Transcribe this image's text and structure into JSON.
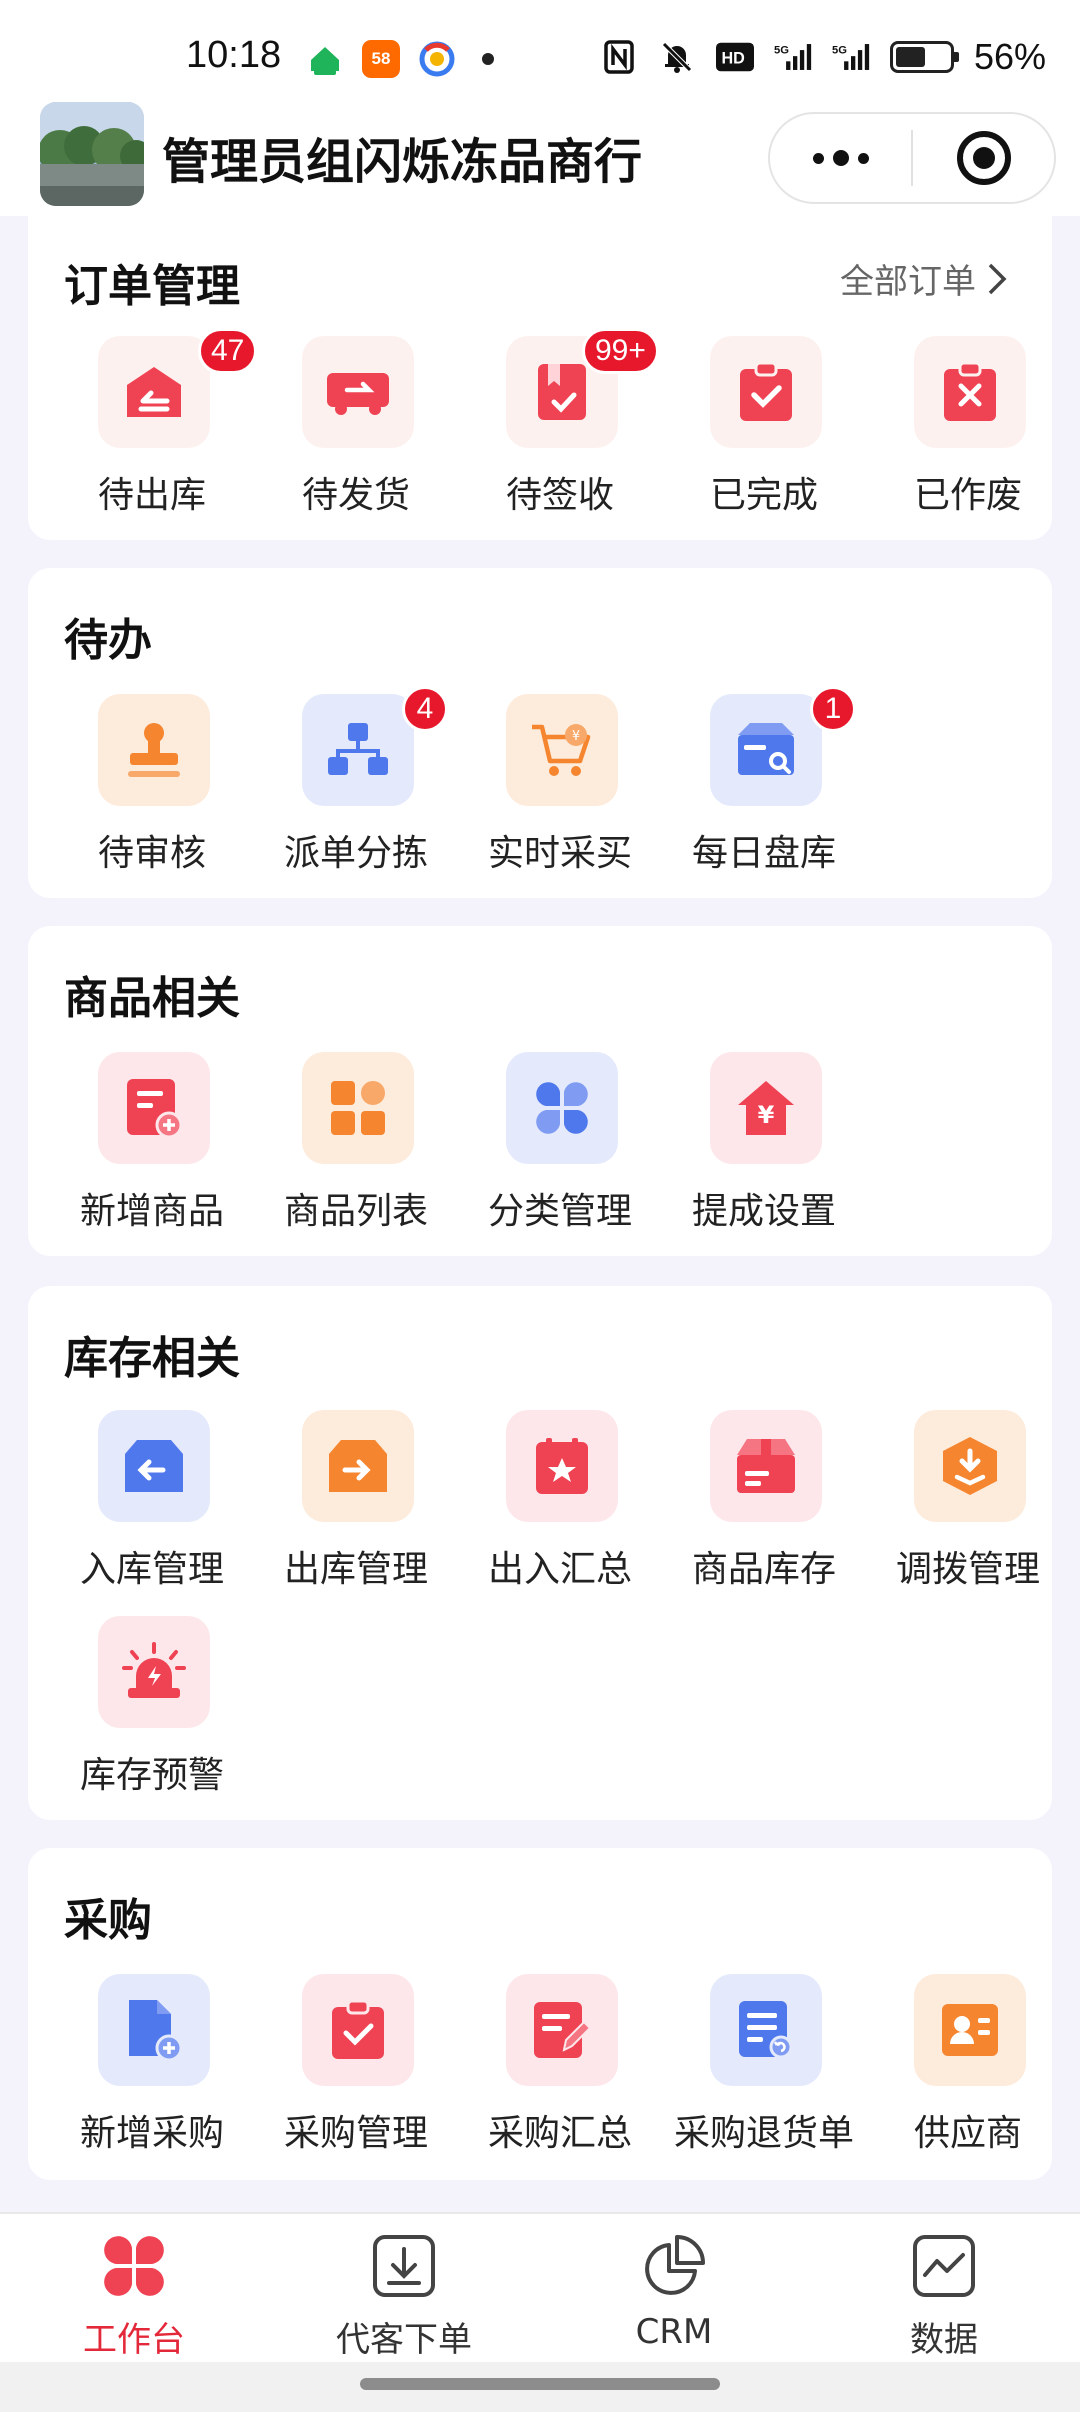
{
  "status_bar": {
    "time": "10:18",
    "battery_percent": "56%",
    "battery_level": 0.56,
    "network_badges": [
      "5G",
      "5G"
    ]
  },
  "header": {
    "title": "管理员组闪烁冻品商行",
    "capsule_icons": [
      "more-dots-icon",
      "close-target-icon"
    ]
  },
  "order_section": {
    "title": "订单管理",
    "link_label": "全部订单",
    "items": [
      {
        "label": "待出库",
        "badge": "47",
        "icon": "outbound-house-icon"
      },
      {
        "label": "待发货",
        "badge": "",
        "icon": "delivery-truck-icon"
      },
      {
        "label": "待签收",
        "badge": "99+",
        "icon": "sign-document-icon"
      },
      {
        "label": "已完成",
        "badge": "",
        "icon": "clipboard-check-icon"
      },
      {
        "label": "已作废",
        "badge": "",
        "icon": "clipboard-x-icon"
      }
    ]
  },
  "todo_section": {
    "title": "待办",
    "items": [
      {
        "label": "待审核",
        "badge": "",
        "icon": "stamp-icon"
      },
      {
        "label": "派单分拣",
        "badge": "4",
        "icon": "flow-chart-icon"
      },
      {
        "label": "实时采买",
        "badge": "",
        "icon": "shopping-cart-icon"
      },
      {
        "label": "每日盘库",
        "badge": "1",
        "icon": "inventory-box-icon"
      }
    ]
  },
  "goods_section": {
    "title": "商品相关",
    "items": [
      {
        "label": "新增商品",
        "icon": "add-product-icon"
      },
      {
        "label": "商品列表",
        "icon": "grid-list-icon"
      },
      {
        "label": "分类管理",
        "icon": "category-icon"
      },
      {
        "label": "提成设置",
        "icon": "commission-house-icon"
      }
    ]
  },
  "stock_section": {
    "title": "库存相关",
    "items": [
      {
        "label": "入库管理",
        "icon": "stock-in-icon"
      },
      {
        "label": "出库管理",
        "icon": "stock-out-icon"
      },
      {
        "label": "出入汇总",
        "icon": "star-calendar-icon"
      },
      {
        "label": "商品库存",
        "icon": "product-box-icon"
      },
      {
        "label": "调拨管理",
        "icon": "transfer-download-icon"
      },
      {
        "label": "库存预警",
        "icon": "alarm-siren-icon"
      }
    ]
  },
  "purchase_section": {
    "title": "采购",
    "items": [
      {
        "label": "新增采购",
        "icon": "new-purchase-doc-icon"
      },
      {
        "label": "采购管理",
        "icon": "purchase-clipboard-icon"
      },
      {
        "label": "采购汇总",
        "icon": "edit-summary-icon"
      },
      {
        "label": "采购退货单",
        "icon": "return-order-icon"
      },
      {
        "label": "供应商",
        "icon": "supplier-card-icon"
      }
    ]
  },
  "bottom_nav": {
    "tabs": [
      {
        "label": "工作台",
        "active": true,
        "icon": "workbench-icon"
      },
      {
        "label": "代客下单",
        "active": false,
        "icon": "order-download-icon"
      },
      {
        "label": "CRM",
        "active": false,
        "icon": "pie-chart-icon"
      },
      {
        "label": "数据",
        "active": false,
        "icon": "trend-chart-icon"
      }
    ]
  },
  "colors": {
    "accent_red": "#e3283a",
    "badge_red": "#e8182c",
    "icon_red": "#ef4354",
    "icon_orange": "#f5862f",
    "icon_blue": "#4f78ec",
    "page_bg": "#f4f2fb"
  }
}
